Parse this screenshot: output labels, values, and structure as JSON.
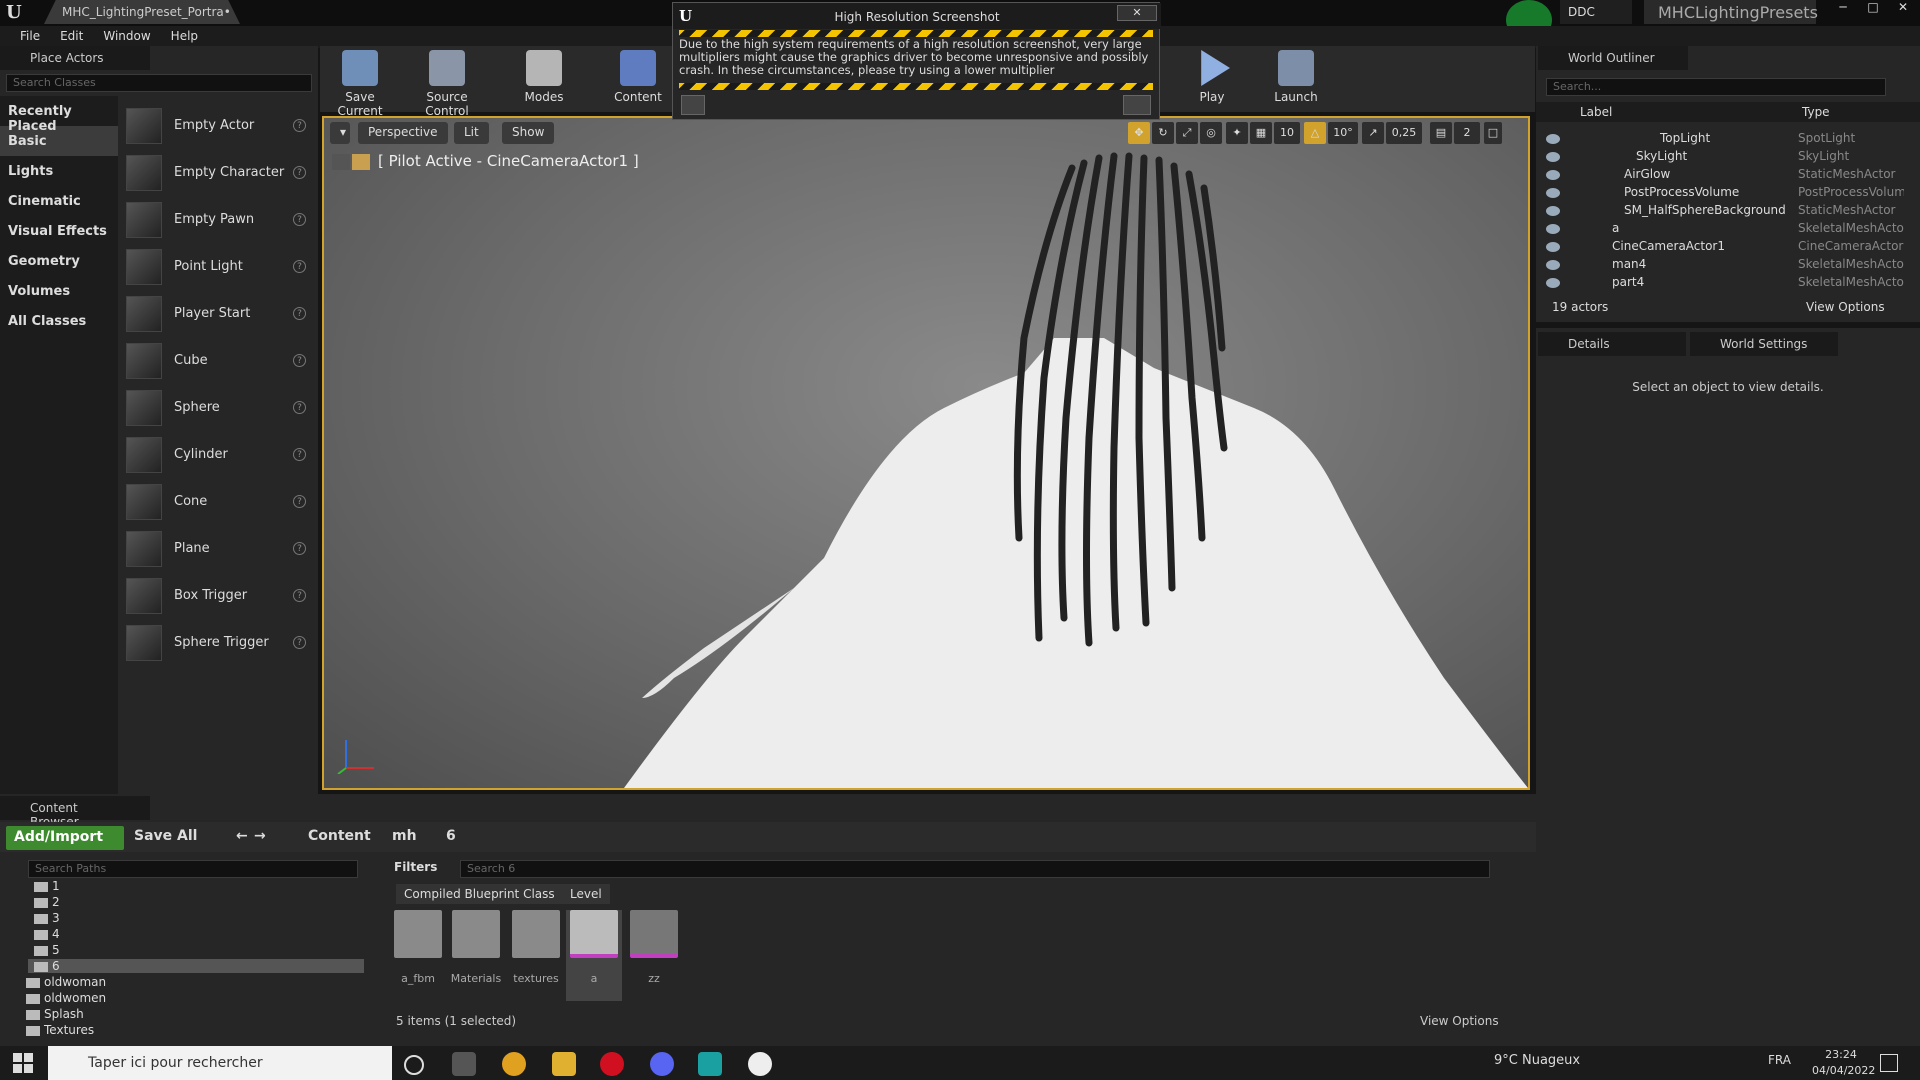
{
  "titlebar": {
    "tab": "MHC_LightingPreset_Portra•",
    "ddc": "DDC",
    "project": "MHCLightingPresets"
  },
  "menu": [
    "File",
    "Edit",
    "Window",
    "Help"
  ],
  "place_actors": {
    "title": "Place Actors",
    "search_placeholder": "Search Classes",
    "categories": [
      "Recently Placed",
      "Basic",
      "Lights",
      "Cinematic",
      "Visual Effects",
      "Geometry",
      "Volumes",
      "All Classes"
    ],
    "items": [
      "Empty Actor",
      "Empty Character",
      "Empty Pawn",
      "Point Light",
      "Player Start",
      "Cube",
      "Sphere",
      "Cylinder",
      "Cone",
      "Plane",
      "Box Trigger",
      "Sphere Trigger"
    ]
  },
  "toolbar": {
    "save_current": "Save Current",
    "source_control": "Source Control",
    "modes": "Modes",
    "content": "Content",
    "play": "Play",
    "launch": "Launch"
  },
  "dialog": {
    "title": "High Resolution Screenshot",
    "close": "✕",
    "message": "Due to the high system requirements of a high resolution screenshot, very large multipliers might cause the graphics driver to become unresponsive and possibly crash. In these circumstances, please try using a lower multiplier"
  },
  "viewport": {
    "perspective": "Perspective",
    "lit": "Lit",
    "show": "Show",
    "pilot": "[ Pilot Active - CineCameraActor1 ]",
    "grid": "10",
    "rotation": "10°",
    "scale": "0,25",
    "camera_speed": "2"
  },
  "outliner": {
    "title": "World Outliner",
    "search_placeholder": "Search...",
    "col_label": "Label",
    "col_type": "Type",
    "rows": [
      {
        "label": "TopLight",
        "type": "SpotLight"
      },
      {
        "label": "SkyLight",
        "type": "SkyLight"
      },
      {
        "label": "AirGlow",
        "type": "StaticMeshActor"
      },
      {
        "label": "PostProcessVolume",
        "type": "PostProcessVolum"
      },
      {
        "label": "SM_HalfSphereBackground",
        "type": "StaticMeshActor"
      },
      {
        "label": "a",
        "type": "SkeletalMeshActo"
      },
      {
        "label": "CineCameraActor1",
        "type": "CineCameraActor"
      },
      {
        "label": "man4",
        "type": "SkeletalMeshActo"
      },
      {
        "label": "part4",
        "type": "SkeletalMeshActo"
      }
    ],
    "count": "19 actors",
    "view_options": "View Options"
  },
  "details": {
    "tab1": "Details",
    "tab2": "World Settings",
    "message": "Select an object to view details."
  },
  "content_browser": {
    "title": "Content Browser",
    "add_import": "Add/Import",
    "save_all": "Save All",
    "crumbs": [
      "Content",
      "mh",
      "6"
    ],
    "paths_placeholder": "Search Paths",
    "tree": [
      "1",
      "2",
      "3",
      "4",
      "5",
      "6",
      "oldwoman",
      "oldwomen",
      "Splash",
      "Textures"
    ],
    "filters": "Filters",
    "search_placeholder": "Search 6",
    "chips": [
      "Compiled Blueprint Class",
      "Level"
    ],
    "assets": [
      "a_fbm",
      "Materials",
      "textures",
      "a",
      "zz"
    ],
    "count": "5 items (1 selected)",
    "view_options": "View Options"
  },
  "taskbar": {
    "search": "Taper ici pour rechercher",
    "weather": "9°C  Nuageux",
    "lang": "FRA",
    "time": "23:24",
    "date": "04/04/2022"
  }
}
